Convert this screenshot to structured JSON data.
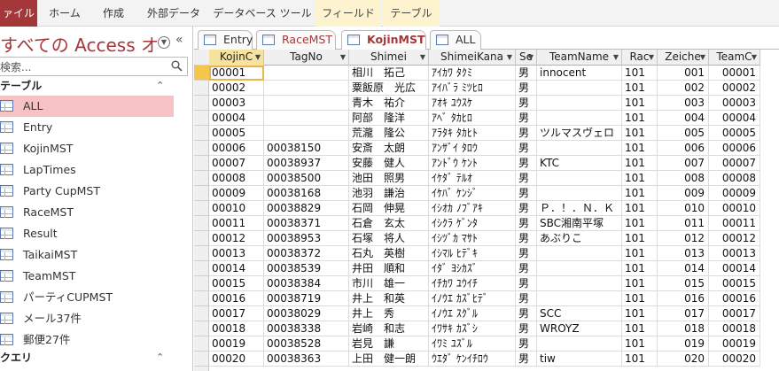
{
  "ribbon": {
    "tabs": [
      {
        "label": "ァイル",
        "type": "file"
      },
      {
        "label": "ホーム",
        "type": "normal"
      },
      {
        "label": "作成",
        "type": "normal"
      },
      {
        "label": "外部データ",
        "type": "normal"
      },
      {
        "label": "データベース ツール",
        "type": "normal"
      },
      {
        "label": "フィールド",
        "type": "context"
      },
      {
        "label": "テーブル",
        "type": "context"
      }
    ]
  },
  "nav": {
    "title": "すべての Access オ...",
    "search_value": "検索...",
    "tables_group": "テーブル",
    "queries_group": "クエリ",
    "items": [
      {
        "label": "ALL",
        "selected": true
      },
      {
        "label": "Entry",
        "selected": false
      },
      {
        "label": "KojinMST",
        "selected": false
      },
      {
        "label": "LapTimes",
        "selected": false
      },
      {
        "label": "Party CupMST",
        "selected": false
      },
      {
        "label": "RaceMST",
        "selected": false
      },
      {
        "label": "Result",
        "selected": false
      },
      {
        "label": "TaikaiMST",
        "selected": false
      },
      {
        "label": "TeamMST",
        "selected": false
      },
      {
        "label": "パーティCUPMST",
        "selected": false
      },
      {
        "label": "メール37件",
        "selected": false
      },
      {
        "label": "郵便27件",
        "selected": false
      }
    ]
  },
  "doc_tabs": [
    {
      "label": "Entry",
      "active": false
    },
    {
      "label": "RaceMST",
      "active": false
    },
    {
      "label": "KojinMST",
      "active": true
    },
    {
      "label": "ALL",
      "active": false
    }
  ],
  "datasheet": {
    "columns": [
      {
        "label": "KojinC",
        "key": true
      },
      {
        "label": "TagNo",
        "key": false
      },
      {
        "label": "Shimei",
        "key": false
      },
      {
        "label": "ShimeiKana",
        "key": false
      },
      {
        "label": "Se",
        "key": false
      },
      {
        "label": "TeamName",
        "key": false
      },
      {
        "label": "Rac",
        "key": false
      },
      {
        "label": "Zeiche",
        "key": false
      },
      {
        "label": "TeamC",
        "key": false
      }
    ],
    "rows": [
      [
        "00001",
        "",
        "相川　拓己",
        "ｱｲｶﾜ ﾀｸﾐ",
        "男",
        "innocent",
        "101",
        "001",
        "00001"
      ],
      [
        "00002",
        "",
        "粟飯原　光広",
        "ｱｲﾊﾞﾗ ﾐﾂﾋﾛ",
        "男",
        "",
        "101",
        "002",
        "00002"
      ],
      [
        "00003",
        "",
        "青木　祐介",
        "ｱｵｷ ﾕｳｽｹ",
        "男",
        "",
        "101",
        "003",
        "00003"
      ],
      [
        "00004",
        "",
        "阿部　隆洋",
        "ｱﾍﾞ ﾀｶﾋﾛ",
        "男",
        "",
        "101",
        "004",
        "00004"
      ],
      [
        "00005",
        "",
        "荒瀧　隆公",
        "ｱﾗﾀｷ ﾀｶﾋﾄ",
        "男",
        "ツルマスヴェロ",
        "101",
        "005",
        "00005"
      ],
      [
        "00006",
        "00038150",
        "安斎　太朗",
        "ｱﾝｻﾞｲ ﾀﾛｳ",
        "男",
        "",
        "101",
        "006",
        "00006"
      ],
      [
        "00007",
        "00038937",
        "安藤　健人",
        "ｱﾝﾄﾞｳ ｹﾝﾄ",
        "男",
        "KTC",
        "101",
        "007",
        "00007"
      ],
      [
        "00008",
        "00038500",
        "池田　照男",
        "ｲｹﾀﾞ ﾃﾙｵ",
        "男",
        "",
        "101",
        "008",
        "00008"
      ],
      [
        "00009",
        "00038168",
        "池羽　謙治",
        "ｲｹﾊﾞ ｹﾝｼﾞ",
        "男",
        "",
        "101",
        "009",
        "00009"
      ],
      [
        "00010",
        "00038829",
        "石岡　伸晃",
        "ｲｼｵｶ ﾉﾌﾞｱｷ",
        "男",
        "Ｐ．！．Ｎ．Ｋ",
        "101",
        "010",
        "00010"
      ],
      [
        "00011",
        "00038371",
        "石倉　玄太",
        "ｲｼｸﾗ ｹﾞﾝﾀ",
        "男",
        "SBC湘南平塚",
        "101",
        "011",
        "00011"
      ],
      [
        "00012",
        "00038953",
        "石塚　将人",
        "ｲｼﾂﾞｶ ﾏｻﾄ",
        "男",
        "あぶりこ",
        "101",
        "012",
        "00012"
      ],
      [
        "00013",
        "00038372",
        "石丸　英樹",
        "ｲｼﾏﾙ ﾋﾃﾞｷ",
        "男",
        "",
        "101",
        "013",
        "00013"
      ],
      [
        "00014",
        "00038539",
        "井田　順和",
        "ｲﾀﾞ ﾖｼｶｽﾞ",
        "男",
        "",
        "101",
        "014",
        "00014"
      ],
      [
        "00015",
        "00038384",
        "市川　雄一",
        "ｲﾁｶﾜ ﾕｳｲﾁ",
        "男",
        "",
        "101",
        "015",
        "00015"
      ],
      [
        "00016",
        "00038719",
        "井上　和英",
        "ｲﾉｳｴ ｶｽﾞﾋﾃﾞ",
        "男",
        "",
        "101",
        "016",
        "00016"
      ],
      [
        "00017",
        "00038029",
        "井上　秀",
        "ｲﾉｳｴ ｽｸﾞﾙ",
        "男",
        "SCC",
        "101",
        "017",
        "00017"
      ],
      [
        "00018",
        "00038338",
        "岩崎　和志",
        "ｲﾜｻｷ ｶｽﾞｼ",
        "男",
        "WROYZ",
        "101",
        "018",
        "00018"
      ],
      [
        "00019",
        "00038528",
        "岩見　謙",
        "ｲﾜﾐ ﾕｽﾞﾙ",
        "男",
        "",
        "101",
        "019",
        "00019"
      ],
      [
        "00020",
        "00038363",
        "上田　健一朗",
        "ｳｴﾀﾞ ｹﾝｲﾁﾛｳ",
        "男",
        "tiw",
        "101",
        "020",
        "00020"
      ]
    ]
  },
  "colors": {
    "accent": "#a4373a",
    "selected_nav": "#f7c2c4",
    "current_row": "#f6c54b",
    "context_tab": "#fdf3cf"
  }
}
